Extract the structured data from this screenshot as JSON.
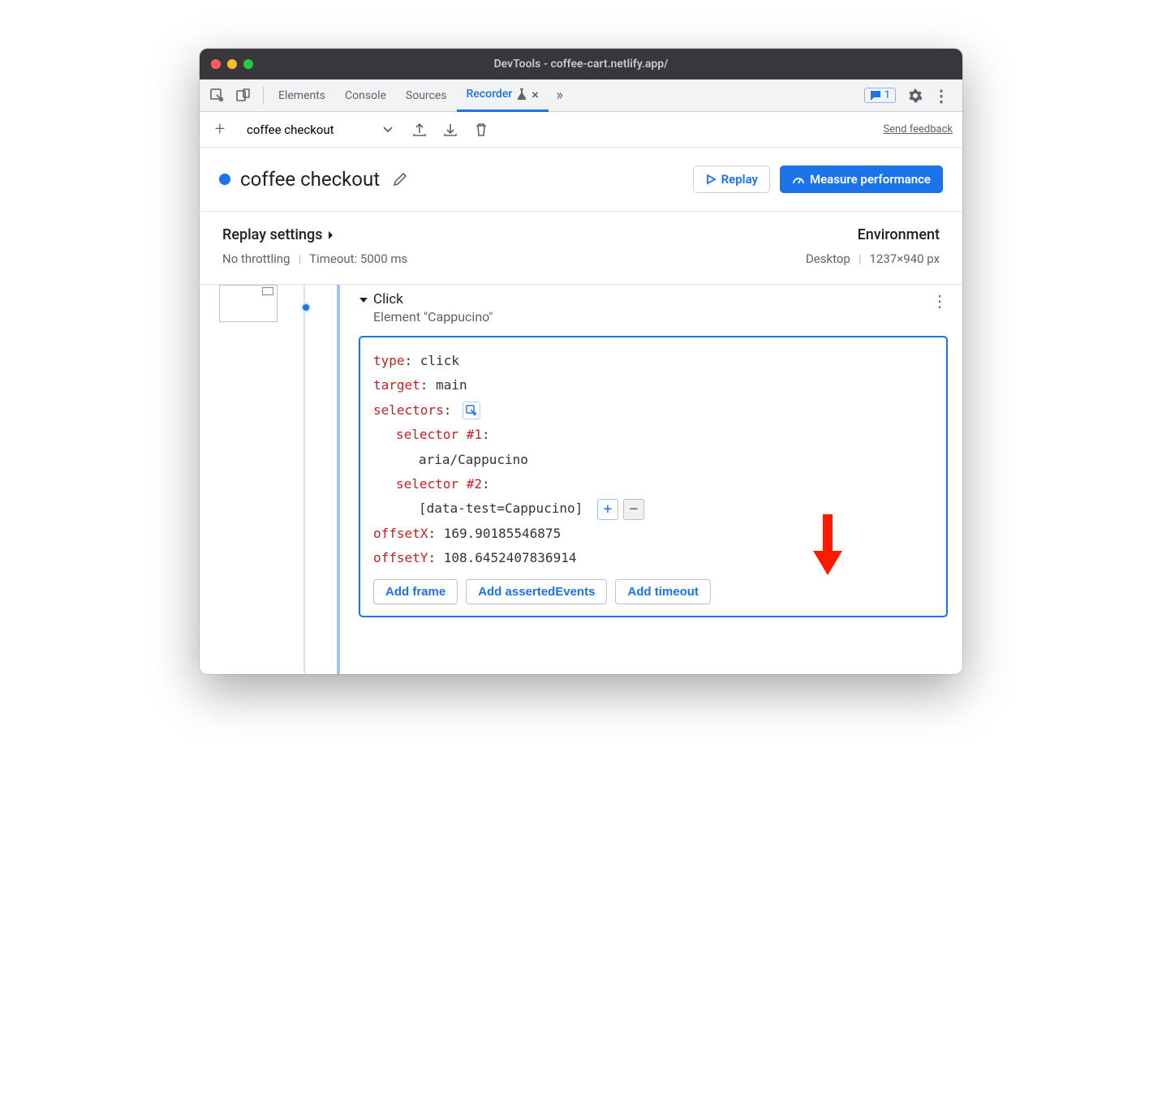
{
  "window_title": "DevTools - coffee-cart.netlify.app/",
  "tabs": {
    "elements": "Elements",
    "console": "Console",
    "sources": "Sources",
    "recorder": "Recorder"
  },
  "feedback_count": "1",
  "toolbar": {
    "recording_name": "coffee checkout",
    "send_feedback": "Send feedback"
  },
  "header": {
    "title": "coffee checkout",
    "replay": "Replay",
    "measure": "Measure performance"
  },
  "settings": {
    "replay_title": "Replay settings",
    "throttling": "No throttling",
    "timeout": "Timeout: 5000 ms",
    "env_title": "Environment",
    "device": "Desktop",
    "viewport": "1237×940 px"
  },
  "step": {
    "name": "Click",
    "element": "Element \"Cappucino\"",
    "type_key": "type",
    "type_val": ": click",
    "target_key": "target",
    "target_val": ": main",
    "selectors_key": "selectors",
    "selectors_colon": ":",
    "sel1_key": "selector #1",
    "sel1_colon": ":",
    "sel1_val": "aria/Cappucino",
    "sel2_key": "selector #2",
    "sel2_colon": ":",
    "sel2_val": "[data-test=Cappucino]",
    "offx_key": "offsetX",
    "offx_val": ": 169.90185546875",
    "offy_key": "offsetY",
    "offy_val": ": 108.6452407836914",
    "add_frame": "Add frame",
    "add_asserted": "Add assertedEvents",
    "add_timeout": "Add timeout"
  }
}
